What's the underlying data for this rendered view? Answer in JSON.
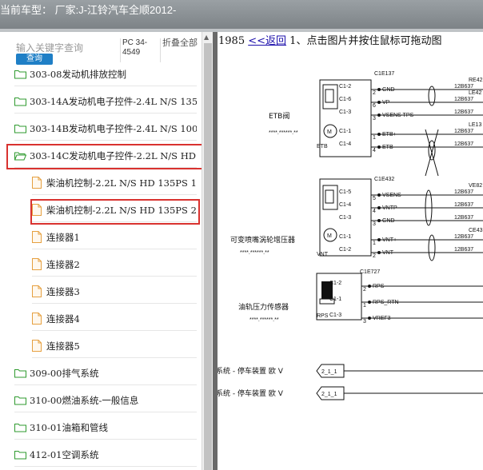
{
  "header": {
    "current_vehicle": "当前车型： 厂家:J-江铃汽车全顺2012-"
  },
  "sidebar": {
    "search_placeholder": "输入关键字查询",
    "search_button": "查询",
    "pc_code": "PC 34-4549",
    "collapse_all": "折叠全部",
    "items": [
      {
        "label": "303-08发动机排放控制",
        "type": "folder"
      },
      {
        "label": "303-14A发动机电子控件-2.4L N/S 135",
        "type": "folder"
      },
      {
        "label": "303-14B发动机电子控件-2.4L N/S 100",
        "type": "folder"
      },
      {
        "label": "303-14C发动机电子控件-2.2L N/S HD",
        "type": "folder-open"
      },
      {
        "label": "柴油机控制-2.2L N/S HD 135PS 1",
        "type": "doc"
      },
      {
        "label": "柴油机控制-2.2L N/S HD 135PS 2",
        "type": "doc"
      },
      {
        "label": "连接器1",
        "type": "doc"
      },
      {
        "label": "连接器2",
        "type": "doc"
      },
      {
        "label": "连接器3",
        "type": "doc"
      },
      {
        "label": "连接器4",
        "type": "doc"
      },
      {
        "label": "连接器5",
        "type": "doc"
      },
      {
        "label": "309-00排气系统",
        "type": "folder"
      },
      {
        "label": "310-00燃油系统-一般信息",
        "type": "folder"
      },
      {
        "label": "310-01油箱和管线",
        "type": "folder"
      },
      {
        "label": "412-01空调系统",
        "type": "folder"
      }
    ]
  },
  "content": {
    "page_number": "1985",
    "back_link": "<<返回",
    "instruction": "1、点击图片并按住鼠标可拖动图",
    "diagram": {
      "etb": {
        "name": "ETB阀",
        "stars": "****.******.**",
        "code": "C1E137",
        "sub": "ETB",
        "pins": [
          {
            "pin": "C1-2",
            "num": "2",
            "sig": "GND",
            "wire": "12B637",
            "dest": "RE42"
          },
          {
            "pin": "C1-6",
            "num": "6",
            "sig": "VP",
            "wire": "12B637",
            "dest": "LE42"
          },
          {
            "pin": "C1-3",
            "num": "3",
            "sig": "VSENS TPS",
            "wire": "12B637",
            "dest": ""
          },
          {
            "pin": "C1-1",
            "num": "1",
            "sig": "ETB+",
            "wire": "12B637",
            "dest": "LE13"
          },
          {
            "pin": "C1-4",
            "num": "4",
            "sig": "ETB-",
            "wire": "12B637",
            "dest": ""
          }
        ]
      },
      "vnt": {
        "name": "可变喷嘴涡轮增压器",
        "stars": "****.******.**",
        "code": "C1E432",
        "sub": "VNT",
        "pins": [
          {
            "pin": "C1-5",
            "num": "5",
            "sig": "VSENS",
            "wire": "12B637",
            "dest": "VE82"
          },
          {
            "pin": "C1-4",
            "num": "4",
            "sig": "VNTP",
            "wire": "12B637",
            "dest": ""
          },
          {
            "pin": "C1-3",
            "num": "3",
            "sig": "GND",
            "wire": "12B637",
            "dest": ""
          },
          {
            "pin": "C1-1",
            "num": "1",
            "sig": "VNT+",
            "wire": "12B637",
            "dest": "CE43"
          },
          {
            "pin": "C1-2",
            "num": "2",
            "sig": "VNT-",
            "wire": "12B637",
            "dest": ""
          }
        ]
      },
      "rps": {
        "name": "油轨压力传感器",
        "stars": "****.******.**",
        "code": "C1E727",
        "sub": "RPS",
        "pins": [
          {
            "pin": "C1-2",
            "num": "2",
            "sig": "RPS"
          },
          {
            "pin": "C1-1",
            "num": "1",
            "sig": "RPS_RTN"
          },
          {
            "pin": "C1-3",
            "num": "3",
            "sig": "VREF3"
          }
        ]
      },
      "refs": [
        {
          "text": "系统 - 停车装置 欧 V",
          "tag": "2_1_1"
        },
        {
          "text": "系统 - 停车装置 欧 V",
          "tag": "2_1_1"
        }
      ]
    }
  }
}
